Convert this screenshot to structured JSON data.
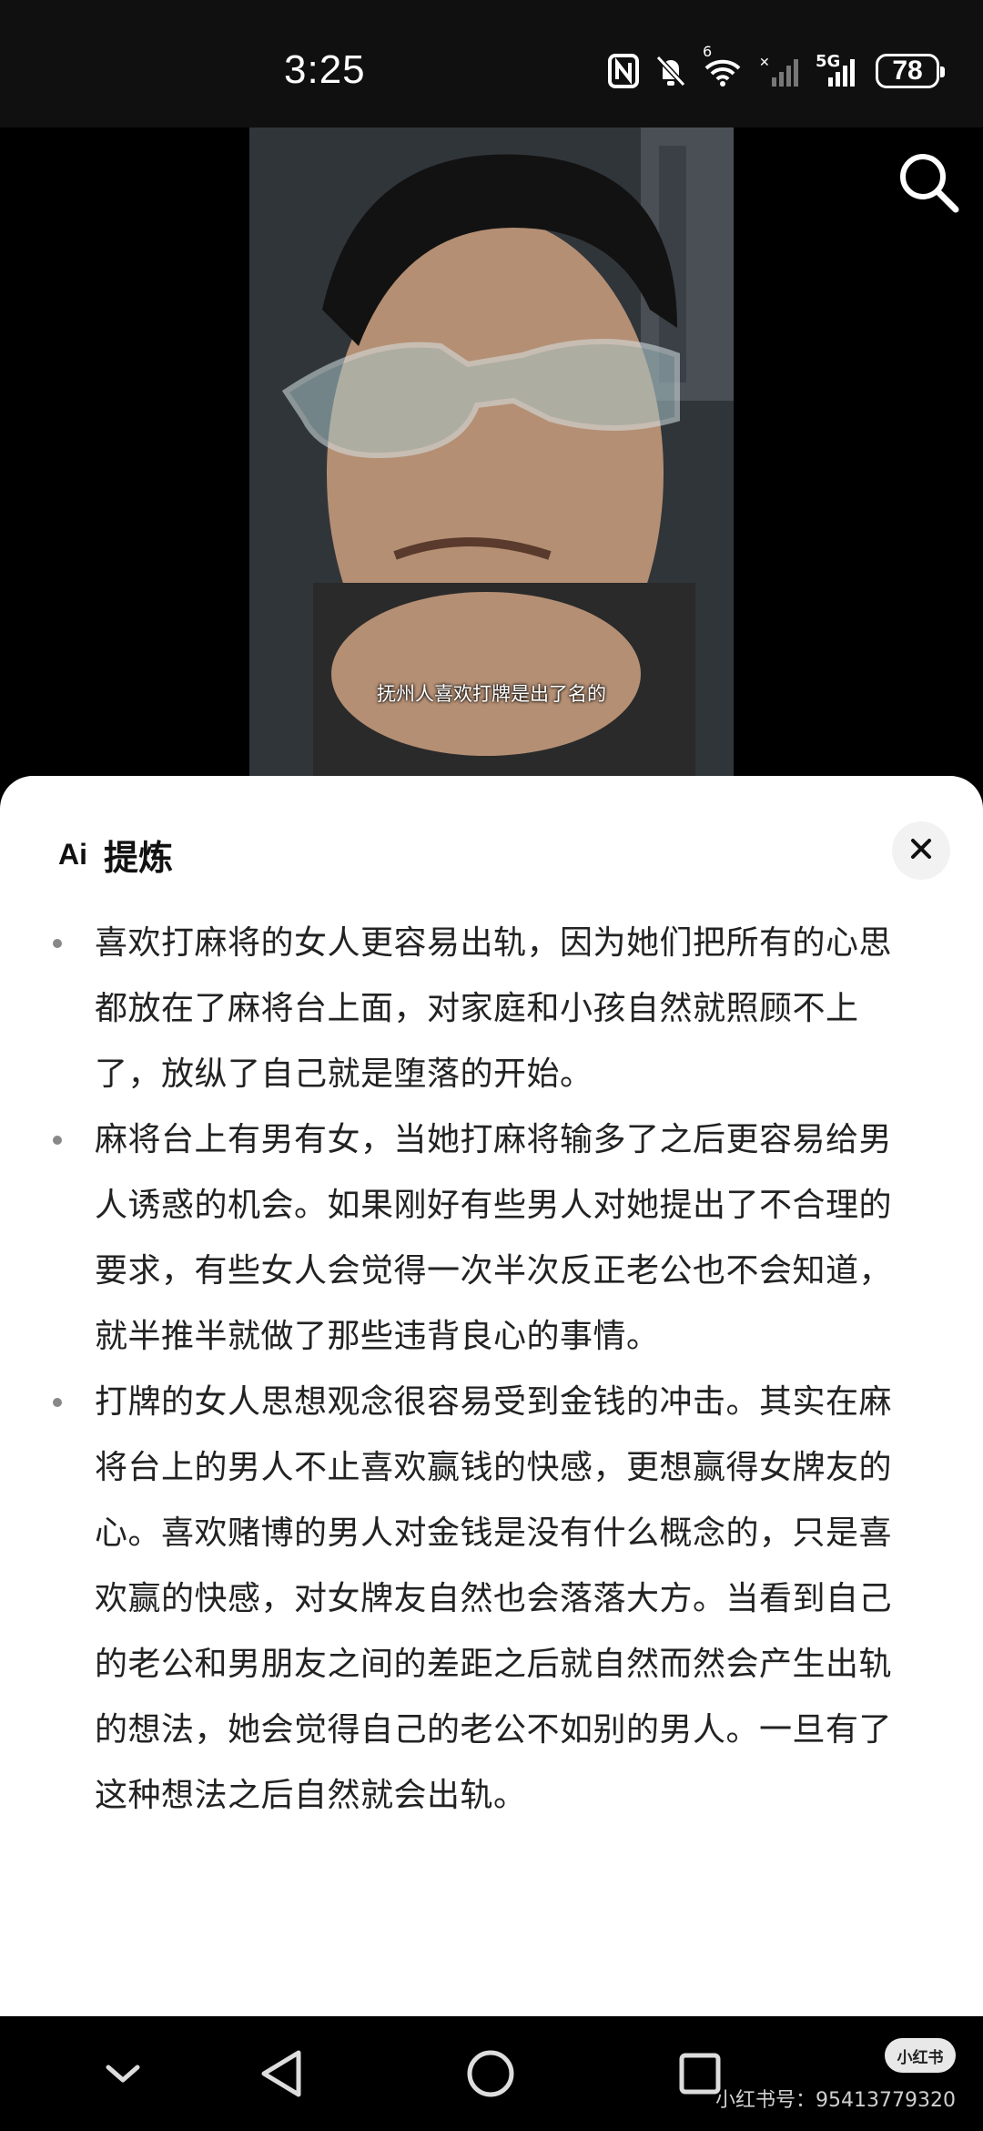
{
  "status_bar": {
    "time": "3:25",
    "network_label": "5G",
    "wifi_label": "6",
    "battery": "78"
  },
  "video": {
    "subtitle": "抚州人喜欢打牌是出了名的"
  },
  "panel": {
    "ai_mark": "Ai",
    "title": "提炼",
    "bullets": [
      "喜欢打麻将的女人更容易出轨，因为她们把所有的心思都放在了麻将台上面，对家庭和小孩自然就照顾不上了，放纵了自己就是堕落的开始。",
      "麻将台上有男有女，当她打麻将输多了之后更容易给男人诱惑的机会。如果刚好有些男人对她提出了不合理的要求，有些女人会觉得一次半次反正老公也不会知道，就半推半就做了那些违背良心的事情。",
      "打牌的女人思想观念很容易受到金钱的冲击。其实在麻将台上的男人不止喜欢赢钱的快感，更想赢得女牌友的心。喜欢赌博的男人对金钱是没有什么概念的，只是喜欢赢的快感，对女牌友自然也会落落大方。当看到自己的老公和男朋友之间的差距之后就自然而然会产生出轨的想法，她会觉得自己的老公不如别的男人。一旦有了这种想法之后自然就会出轨。"
    ]
  },
  "watermark": {
    "logo": "小红书",
    "text": "小红书号：95413779320"
  },
  "colors": {
    "sheet_bg": "#ffffff",
    "status_bg": "#101010",
    "bullet_text": "#222222"
  },
  "icons": [
    "nfc-icon",
    "mute-bell-icon",
    "wifi-icon",
    "signal-icon",
    "search-icon",
    "close-icon",
    "chevron-down-icon",
    "back-icon",
    "home-icon",
    "recents-icon"
  ]
}
